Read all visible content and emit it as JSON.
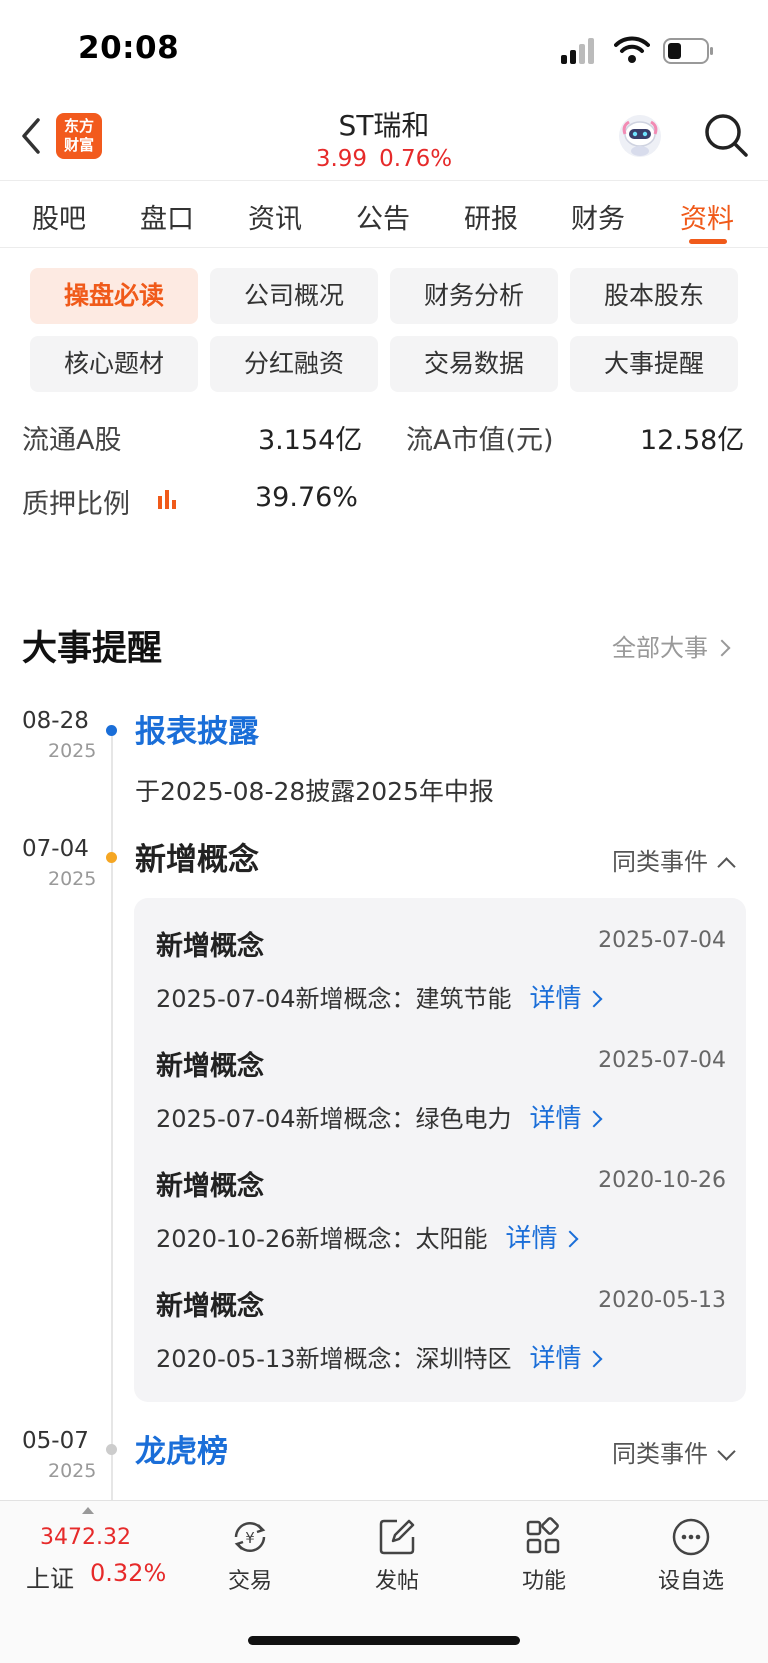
{
  "status_bar": {
    "time": "20:08"
  },
  "header": {
    "logo_text_line1": "东方",
    "logo_text_line2": "财富",
    "title": "ST瑞和",
    "price": "3.99",
    "change_pct": "0.76%"
  },
  "tabs": [
    {
      "label": "股吧"
    },
    {
      "label": "盘口"
    },
    {
      "label": "资讯"
    },
    {
      "label": "公告"
    },
    {
      "label": "研报"
    },
    {
      "label": "财务"
    },
    {
      "label": "资料",
      "active": true
    }
  ],
  "chips": [
    {
      "label": "操盘必读",
      "active": true
    },
    {
      "label": "公司概况"
    },
    {
      "label": "财务分析"
    },
    {
      "label": "股本股东"
    },
    {
      "label": "核心题材"
    },
    {
      "label": "分红融资"
    },
    {
      "label": "交易数据"
    },
    {
      "label": "大事提醒"
    }
  ],
  "metrics": {
    "float_a_label": "流通A股",
    "float_a_value": "3.154亿",
    "float_cap_label": "流A市值(元)",
    "float_cap_value": "12.58亿",
    "pledge_label": "质押比例",
    "pledge_value": "39.76%"
  },
  "events_section": {
    "title": "大事提醒",
    "more_label": "全部大事",
    "events": [
      {
        "date": "08-28",
        "year": "2025",
        "title": "报表披露",
        "desc": "于2025-08-28披露2025年中报"
      },
      {
        "date": "07-04",
        "year": "2025",
        "title": "新增概念",
        "same_label": "同类事件",
        "items": [
          {
            "title": "新增概念",
            "date": "2025-07-04",
            "text": "2025-07-04新增概念：建筑节能",
            "detail": "详情"
          },
          {
            "title": "新增概念",
            "date": "2025-07-04",
            "text": "2025-07-04新增概念：绿色电力",
            "detail": "详情"
          },
          {
            "title": "新增概念",
            "date": "2020-10-26",
            "text": "2020-10-26新增概念：太阳能",
            "detail": "详情"
          },
          {
            "title": "新增概念",
            "date": "2020-05-13",
            "text": "2020-05-13新增概念：深圳特区",
            "detail": "详情"
          }
        ]
      },
      {
        "date": "05-07",
        "year": "2025",
        "title": "龙虎榜",
        "same_label": "同类事件"
      }
    ]
  },
  "bottom_bar": {
    "index_value": "3472.32",
    "index_name": "上证",
    "index_pct": "0.32%",
    "nav": [
      {
        "label": "交易",
        "icon": "yuan-cycle-icon"
      },
      {
        "label": "发帖",
        "icon": "edit-icon"
      },
      {
        "label": "功能",
        "icon": "grid-icon"
      },
      {
        "label": "设自选",
        "icon": "more-icon"
      }
    ]
  },
  "colors": {
    "accent": "#f05a1a",
    "up_red": "#e62a2a",
    "link_blue": "#1a6ed8",
    "dot_orange": "#f5a623"
  }
}
